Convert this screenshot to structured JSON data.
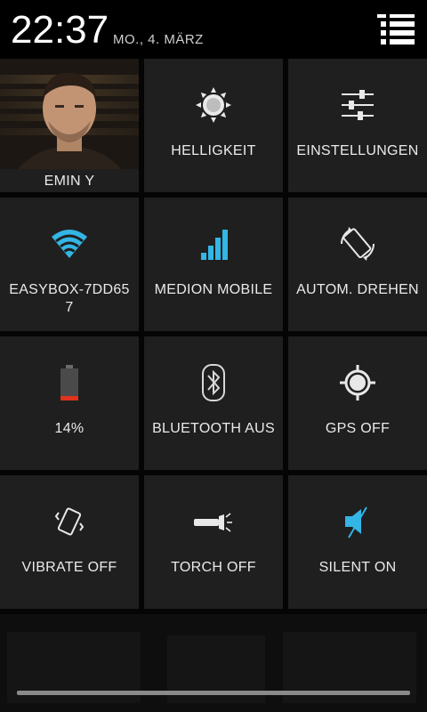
{
  "status": {
    "time": "22:37",
    "date": "MO., 4. MÄRZ"
  },
  "tiles": {
    "profile": {
      "label": "EMIN Y"
    },
    "brightness": {
      "label": "HELLIGKEIT",
      "icon": "brightness-icon"
    },
    "settings": {
      "label": "EINSTELLUNGEN",
      "icon": "settings-sliders-icon"
    },
    "wifi": {
      "label_line1": "EASYBOX-7DD65",
      "label_line2": "7",
      "icon": "wifi-icon"
    },
    "mobile": {
      "label": "MEDION MOBILE",
      "icon": "signal-icon"
    },
    "rotate": {
      "label": "AUTOM. DREHEN",
      "icon": "auto-rotate-icon"
    },
    "battery": {
      "label": "14%",
      "level": 0.14,
      "icon": "battery-icon"
    },
    "bluetooth": {
      "label": "BLUETOOTH AUS",
      "icon": "bluetooth-icon"
    },
    "gps": {
      "label": "GPS OFF",
      "icon": "gps-icon"
    },
    "vibrate": {
      "label": "VIBRATE OFF",
      "icon": "vibrate-icon"
    },
    "torch": {
      "label": "TORCH OFF",
      "icon": "torch-icon"
    },
    "silent": {
      "label": "SILENT ON",
      "icon": "silent-icon"
    }
  },
  "colors": {
    "accent": "#33b5e5",
    "battery_low": "#e0331d",
    "tile_bg": "#1f1f1f"
  }
}
